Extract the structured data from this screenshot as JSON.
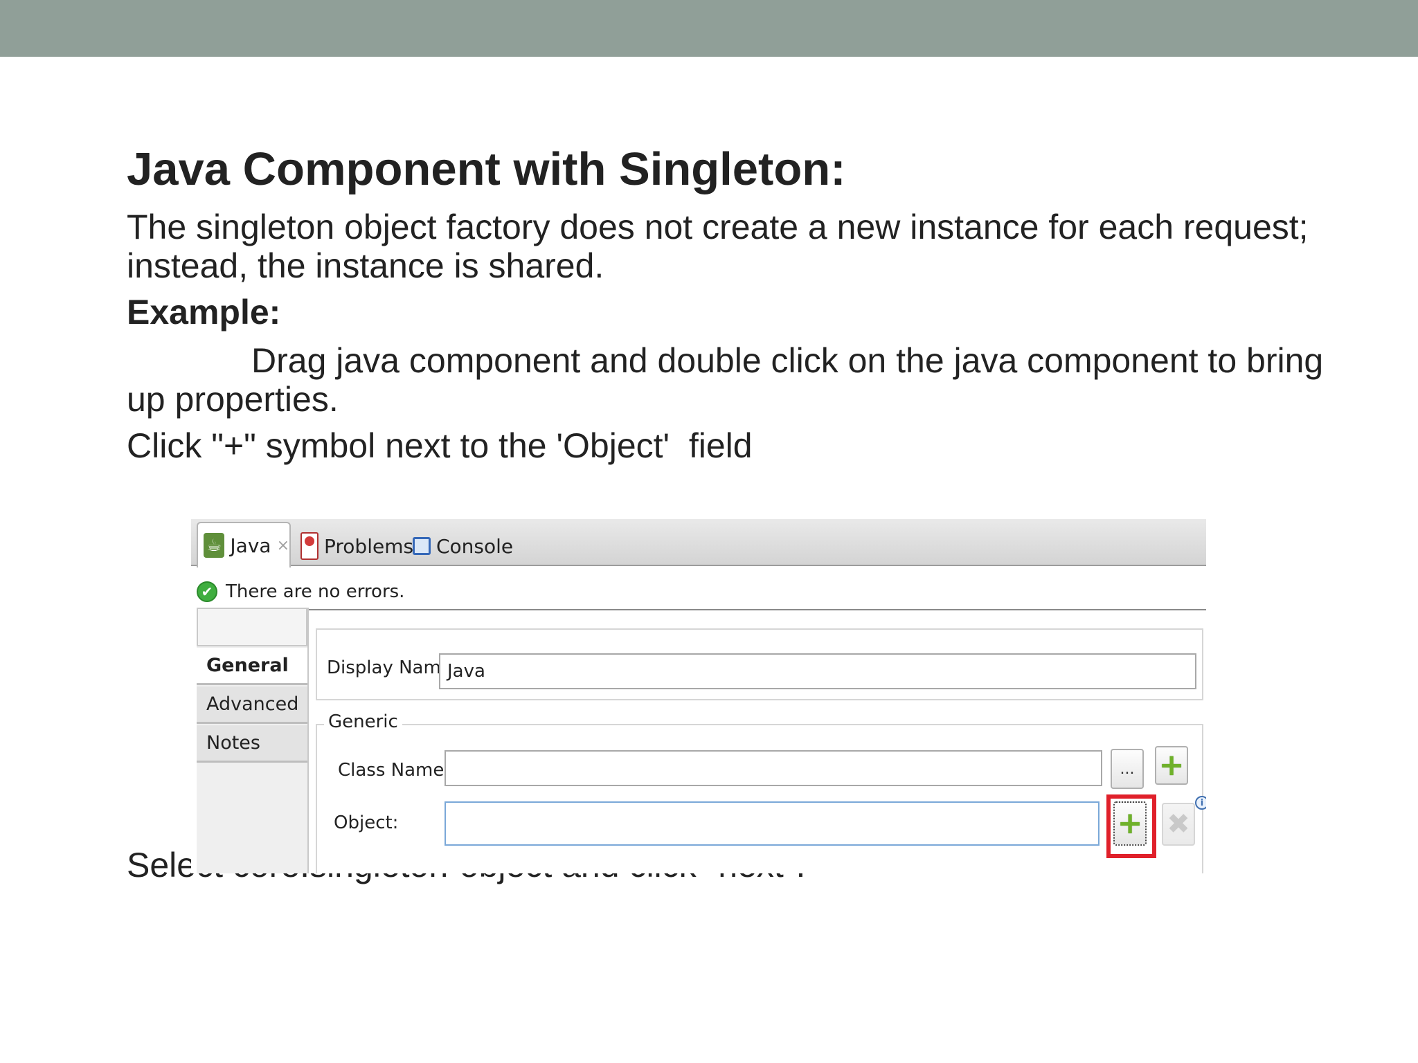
{
  "slide": {
    "title": "Java Component with Singleton:",
    "paragraph1": "The singleton object factory does not create a new instance for each request; instead, the instance is shared.",
    "example_label": "Example:",
    "paragraph2": "Drag java component and double click on the java component to bring up properties.",
    "paragraph3": "Click \"+\" symbol next to the 'Object'  field",
    "paragraph4": "Select  core:singleton-object and click \"next\"."
  },
  "screenshot": {
    "tabs": [
      {
        "label": "Java",
        "icon": "java-component-icon",
        "closable": true
      },
      {
        "label": "Problems",
        "icon": "problems-icon"
      },
      {
        "label": "Console",
        "icon": "console-icon"
      }
    ],
    "status_text": "There are no errors.",
    "side_nav": [
      "General",
      "Advanced",
      "Notes"
    ],
    "display_name_label": "Display Name:",
    "display_name_value": "Java",
    "generic_legend": "Generic",
    "class_name_label": "Class Name:",
    "class_name_value": "",
    "browse_button_label": "...",
    "object_label": "Object:",
    "object_value": "",
    "plus_symbol": "+",
    "remove_symbol": "✖",
    "info_symbol": "i",
    "check_symbol": "✔",
    "close_symbol": "×",
    "java_glyph": "☕"
  },
  "colors": {
    "top_band": "#909f98",
    "highlight": "#e0202a",
    "plus_green": "#6fb12a"
  }
}
